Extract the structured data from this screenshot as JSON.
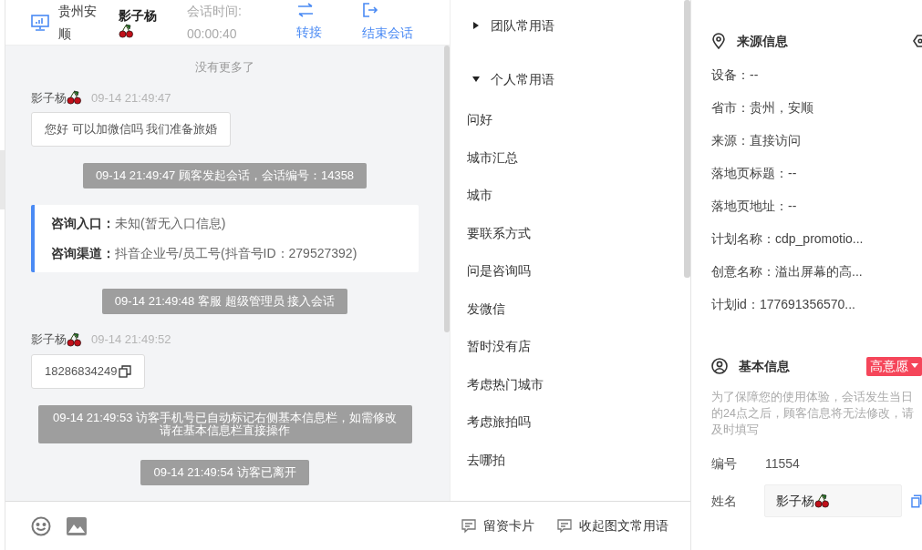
{
  "header": {
    "location": "贵州安顺",
    "customer": "影子杨",
    "session_label": "会话时间:",
    "session_time": "00:00:40",
    "actions": [
      {
        "kind": "transfer",
        "label": "转接"
      },
      {
        "kind": "end",
        "label": "结束会话"
      }
    ]
  },
  "chat": {
    "no_more": "没有更多了",
    "messages": [
      {
        "kind": "customer",
        "name": "影子杨",
        "time": "09-14 21:49:47",
        "text": "您好 可以加微信吗 我们准备旅婚",
        "copyable": false
      },
      {
        "kind": "system",
        "text": "09-14 21:49:47 顾客发起会话，会话编号：14358"
      },
      {
        "kind": "info",
        "rows": [
          {
            "label": "咨询入口：",
            "value": "未知(暂无入口信息)"
          },
          {
            "label": "咨询渠道：",
            "value": "抖音企业号/员工号(抖音号ID：279527392)"
          }
        ]
      },
      {
        "kind": "system",
        "text": "09-14 21:49:48 客服 超级管理员 接入会话"
      },
      {
        "kind": "customer",
        "name": "影子杨",
        "time": "09-14 21:49:52",
        "text": "18286834249",
        "copyable": true
      },
      {
        "kind": "system",
        "text": "09-14 21:49:53 访客手机号已自动标记右侧基本信息栏，如需修改请在基本信息栏直接操作"
      },
      {
        "kind": "system",
        "text": "09-14 21:49:54 访客已离开"
      }
    ]
  },
  "quick_phrases": {
    "groups": [
      {
        "label": "团队常用语",
        "expanded": false
      },
      {
        "label": "个人常用语",
        "expanded": true,
        "items": [
          "问好",
          "城市汇总",
          "城市",
          "要联系方式",
          "问是咨询吗",
          "发微信",
          "暂时没有店",
          "考虑热门城市",
          "考虑旅拍吗",
          "去哪拍"
        ]
      }
    ]
  },
  "toolbar": {
    "actions": [
      {
        "label": "留资卡片"
      },
      {
        "label": "收起图文常用语"
      }
    ]
  },
  "source_info": {
    "title": "来源信息",
    "rows": [
      "设备：--",
      "省市：贵州，安顺",
      "来源：直接访问",
      "落地页标题：--",
      "落地页地址：--",
      "计划名称：cdp_promotio...",
      "创意名称：溢出屏幕的高...",
      "计划id：177691356570..."
    ]
  },
  "basic_info": {
    "title": "基本信息",
    "intent": "高意愿",
    "notice": "为了保障您的使用体验，会话发生当日的24点之后，顾客信息将无法修改，请及时填写",
    "id_label": "编号",
    "id_value": "11554",
    "name_label": "姓名",
    "name_value": "影子杨"
  }
}
